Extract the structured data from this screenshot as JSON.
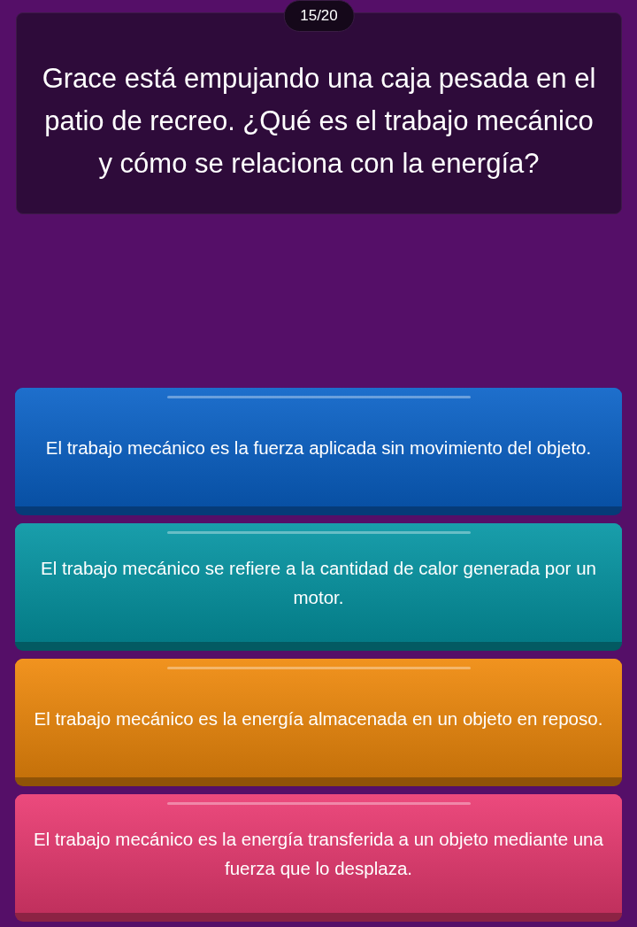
{
  "progress": "15/20",
  "question": "Grace está empujando una caja pesada en el patio de recreo. ¿Qué es el trabajo mecánico y cómo se relaciona con la energía?",
  "answers": [
    {
      "text": "El trabajo mecánico es la fuerza aplicada sin movimiento del objeto.",
      "color": "#0a62c8"
    },
    {
      "text": "El trabajo mecánico se refiere a la cantidad de calor generada por un motor.",
      "color": "#0596a4"
    },
    {
      "text": "El trabajo mecánico es la energía almacenada en un objeto en reposo.",
      "color": "#f08a0c"
    },
    {
      "text": "El trabajo mecánico es la energía transferida a un objeto mediante una fuerza que lo desplaza.",
      "color": "#ea3a72"
    }
  ]
}
